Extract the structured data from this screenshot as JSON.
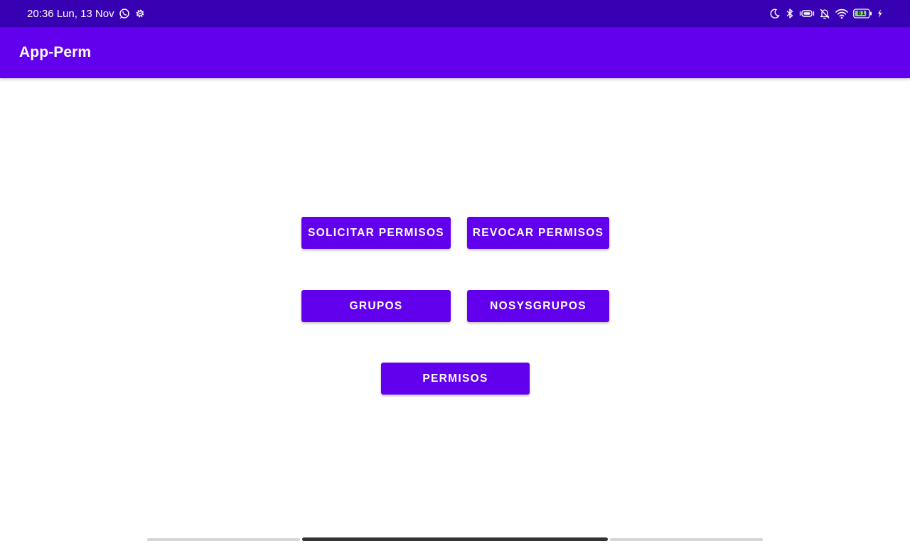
{
  "status_bar": {
    "time_date": "20:36 Lun, 13 Nov",
    "left_icons": [
      "whatsapp-icon",
      "settings-gear-icon"
    ],
    "right_icons": [
      "moon-icon",
      "bluetooth-icon",
      "vibrate-icon",
      "bell-off-icon",
      "wifi-icon",
      "battery-icon",
      "charging-bolt-icon"
    ],
    "battery_level": "81",
    "background_color": "#3700b3"
  },
  "app_bar": {
    "title": "App-Perm",
    "background_color": "#6200ee"
  },
  "buttons": {
    "solicitar_permisos": "SOLICITAR PERMISOS",
    "revocar_permisos": "REVOCAR PERMISOS",
    "grupos": "GRUPOS",
    "nosysgrupos": "NOSYSGRUPOS",
    "permisos": "PERMISOS",
    "color": "#6200ee"
  }
}
